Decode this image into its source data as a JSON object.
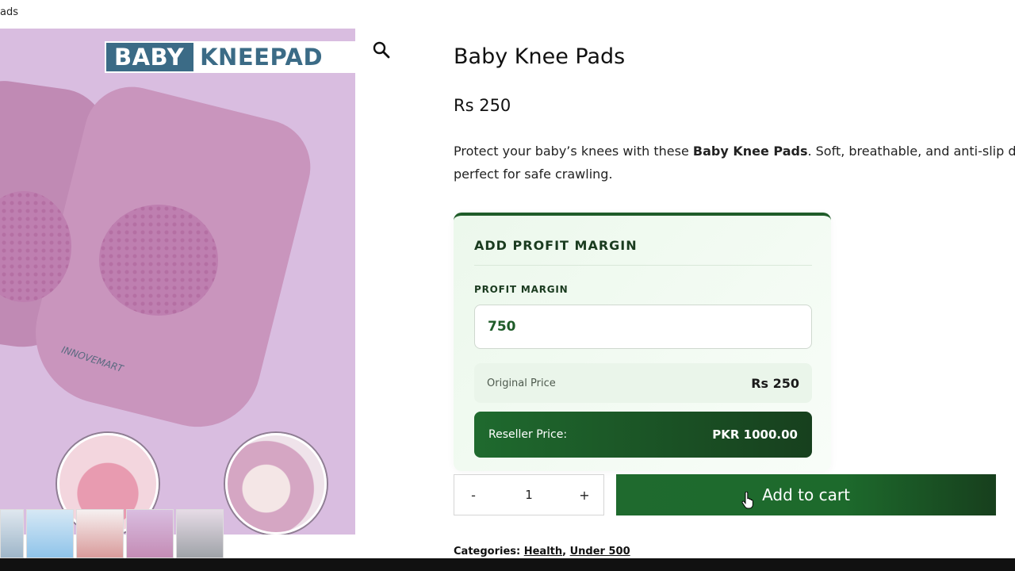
{
  "breadcrumb": {
    "text": "ads"
  },
  "gallery": {
    "banner_word1": "BABY",
    "banner_word2": "KNEEPAD",
    "brand_stamp": "INNOVEMART",
    "zoom_icon": "search-icon",
    "thumbnails": [
      {
        "name": "gallery-thumb-1"
      },
      {
        "name": "gallery-thumb-2"
      },
      {
        "name": "gallery-thumb-3"
      },
      {
        "name": "gallery-thumb-4"
      },
      {
        "name": "gallery-thumb-5"
      }
    ]
  },
  "product": {
    "title": "Baby Knee Pads",
    "price": "Rs 250",
    "description_pre": "Protect your baby’s knees with these ",
    "description_bold": "Baby Knee Pads",
    "description_post": ". Soft, breathable, and anti-slip design-",
    "description_line2": "perfect for safe crawling."
  },
  "profit_card": {
    "heading": "ADD PROFIT MARGIN",
    "margin_label": "PROFIT MARGIN",
    "margin_value": "750",
    "original_label": "Original Price",
    "original_value": "Rs 250",
    "reseller_label": "Reseller Price:",
    "reseller_value": "PKR 1000.00"
  },
  "cart": {
    "minus": "-",
    "qty": "1",
    "plus": "+",
    "add_label": "Add to cart"
  },
  "categories": {
    "label": "Categories:",
    "items": [
      "Health",
      "Under 500"
    ]
  },
  "colors": {
    "accent_green": "#1f6a2e",
    "dark_green": "#17401e",
    "image_bg": "#d9bde0"
  }
}
